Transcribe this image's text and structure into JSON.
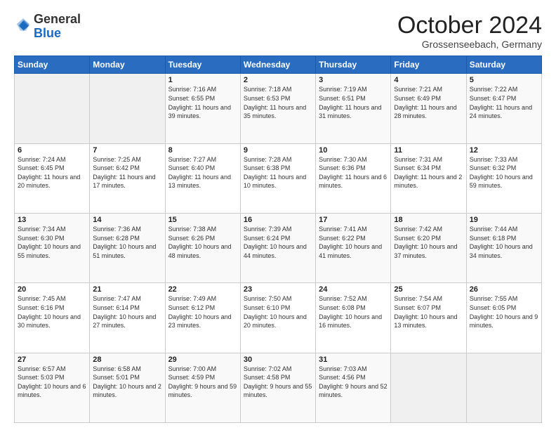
{
  "logo": {
    "general": "General",
    "blue": "Blue"
  },
  "header": {
    "month": "October 2024",
    "location": "Grossenseebach, Germany"
  },
  "weekdays": [
    "Sunday",
    "Monday",
    "Tuesday",
    "Wednesday",
    "Thursday",
    "Friday",
    "Saturday"
  ],
  "weeks": [
    [
      {
        "day": "",
        "info": ""
      },
      {
        "day": "",
        "info": ""
      },
      {
        "day": "1",
        "info": "Sunrise: 7:16 AM\nSunset: 6:55 PM\nDaylight: 11 hours and 39 minutes."
      },
      {
        "day": "2",
        "info": "Sunrise: 7:18 AM\nSunset: 6:53 PM\nDaylight: 11 hours and 35 minutes."
      },
      {
        "day": "3",
        "info": "Sunrise: 7:19 AM\nSunset: 6:51 PM\nDaylight: 11 hours and 31 minutes."
      },
      {
        "day": "4",
        "info": "Sunrise: 7:21 AM\nSunset: 6:49 PM\nDaylight: 11 hours and 28 minutes."
      },
      {
        "day": "5",
        "info": "Sunrise: 7:22 AM\nSunset: 6:47 PM\nDaylight: 11 hours and 24 minutes."
      }
    ],
    [
      {
        "day": "6",
        "info": "Sunrise: 7:24 AM\nSunset: 6:45 PM\nDaylight: 11 hours and 20 minutes."
      },
      {
        "day": "7",
        "info": "Sunrise: 7:25 AM\nSunset: 6:42 PM\nDaylight: 11 hours and 17 minutes."
      },
      {
        "day": "8",
        "info": "Sunrise: 7:27 AM\nSunset: 6:40 PM\nDaylight: 11 hours and 13 minutes."
      },
      {
        "day": "9",
        "info": "Sunrise: 7:28 AM\nSunset: 6:38 PM\nDaylight: 11 hours and 10 minutes."
      },
      {
        "day": "10",
        "info": "Sunrise: 7:30 AM\nSunset: 6:36 PM\nDaylight: 11 hours and 6 minutes."
      },
      {
        "day": "11",
        "info": "Sunrise: 7:31 AM\nSunset: 6:34 PM\nDaylight: 11 hours and 2 minutes."
      },
      {
        "day": "12",
        "info": "Sunrise: 7:33 AM\nSunset: 6:32 PM\nDaylight: 10 hours and 59 minutes."
      }
    ],
    [
      {
        "day": "13",
        "info": "Sunrise: 7:34 AM\nSunset: 6:30 PM\nDaylight: 10 hours and 55 minutes."
      },
      {
        "day": "14",
        "info": "Sunrise: 7:36 AM\nSunset: 6:28 PM\nDaylight: 10 hours and 51 minutes."
      },
      {
        "day": "15",
        "info": "Sunrise: 7:38 AM\nSunset: 6:26 PM\nDaylight: 10 hours and 48 minutes."
      },
      {
        "day": "16",
        "info": "Sunrise: 7:39 AM\nSunset: 6:24 PM\nDaylight: 10 hours and 44 minutes."
      },
      {
        "day": "17",
        "info": "Sunrise: 7:41 AM\nSunset: 6:22 PM\nDaylight: 10 hours and 41 minutes."
      },
      {
        "day": "18",
        "info": "Sunrise: 7:42 AM\nSunset: 6:20 PM\nDaylight: 10 hours and 37 minutes."
      },
      {
        "day": "19",
        "info": "Sunrise: 7:44 AM\nSunset: 6:18 PM\nDaylight: 10 hours and 34 minutes."
      }
    ],
    [
      {
        "day": "20",
        "info": "Sunrise: 7:45 AM\nSunset: 6:16 PM\nDaylight: 10 hours and 30 minutes."
      },
      {
        "day": "21",
        "info": "Sunrise: 7:47 AM\nSunset: 6:14 PM\nDaylight: 10 hours and 27 minutes."
      },
      {
        "day": "22",
        "info": "Sunrise: 7:49 AM\nSunset: 6:12 PM\nDaylight: 10 hours and 23 minutes."
      },
      {
        "day": "23",
        "info": "Sunrise: 7:50 AM\nSunset: 6:10 PM\nDaylight: 10 hours and 20 minutes."
      },
      {
        "day": "24",
        "info": "Sunrise: 7:52 AM\nSunset: 6:08 PM\nDaylight: 10 hours and 16 minutes."
      },
      {
        "day": "25",
        "info": "Sunrise: 7:54 AM\nSunset: 6:07 PM\nDaylight: 10 hours and 13 minutes."
      },
      {
        "day": "26",
        "info": "Sunrise: 7:55 AM\nSunset: 6:05 PM\nDaylight: 10 hours and 9 minutes."
      }
    ],
    [
      {
        "day": "27",
        "info": "Sunrise: 6:57 AM\nSunset: 5:03 PM\nDaylight: 10 hours and 6 minutes."
      },
      {
        "day": "28",
        "info": "Sunrise: 6:58 AM\nSunset: 5:01 PM\nDaylight: 10 hours and 2 minutes."
      },
      {
        "day": "29",
        "info": "Sunrise: 7:00 AM\nSunset: 4:59 PM\nDaylight: 9 hours and 59 minutes."
      },
      {
        "day": "30",
        "info": "Sunrise: 7:02 AM\nSunset: 4:58 PM\nDaylight: 9 hours and 55 minutes."
      },
      {
        "day": "31",
        "info": "Sunrise: 7:03 AM\nSunset: 4:56 PM\nDaylight: 9 hours and 52 minutes."
      },
      {
        "day": "",
        "info": ""
      },
      {
        "day": "",
        "info": ""
      }
    ]
  ]
}
